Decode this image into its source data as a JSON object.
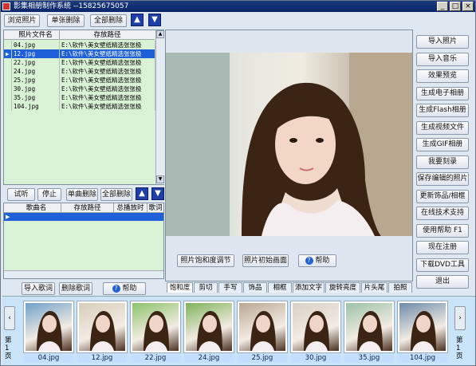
{
  "window": {
    "title": "影集相册制作系统 --15825675057"
  },
  "photo_toolbar": {
    "browse": "浏览照片",
    "delete_one": "单张删除",
    "delete_all": "全部删除"
  },
  "photo_table": {
    "headers": [
      "照片文件名",
      "存放路径"
    ],
    "rows": [
      {
        "name": "04.jpg",
        "path": "E:\\软件\\美女壁纸精选张张极"
      },
      {
        "name": "12.jpg",
        "path": "E:\\软件\\美女壁纸精选张张极"
      },
      {
        "name": "22.jpg",
        "path": "E:\\软件\\美女壁纸精选张张极"
      },
      {
        "name": "24.jpg",
        "path": "E:\\软件\\美女壁纸精选张张极"
      },
      {
        "name": "25.jpg",
        "path": "E:\\软件\\美女壁纸精选张张极"
      },
      {
        "name": "30.jpg",
        "path": "E:\\软件\\美女壁纸精选张张极"
      },
      {
        "name": "35.jpg",
        "path": "E:\\软件\\美女壁纸精选张张极"
      },
      {
        "name": "104.jpg",
        "path": "E:\\软件\\美女壁纸精选张张极"
      }
    ],
    "selected_index": 1
  },
  "music_toolbar": {
    "listen": "试听",
    "stop": "停止",
    "delete_one": "单曲删除",
    "delete_all": "全部删除"
  },
  "music_table": {
    "headers": [
      "歌曲名",
      "存放路径",
      "总播放时间",
      "歌词"
    ]
  },
  "lyrics_toolbar": {
    "import": "导入歌词",
    "delete": "删除歌词",
    "help": "帮助"
  },
  "preview_toolbar": {
    "saturation": "照片饱和度调节",
    "init": "照片初始画面",
    "help": "帮助"
  },
  "tabs": [
    "饱和度",
    "剪切",
    "手写",
    "饰品",
    "相框",
    "添加文字",
    "旋转亮度",
    "片头尾",
    "拍照"
  ],
  "side_buttons": [
    "导入照片",
    "导入音乐",
    "效果预览",
    "生成电子相册",
    "生成Flash相册",
    "生成视频文件",
    "生成GIF相册",
    "我要刻录",
    "保存编辑的照片",
    "更新饰品/相框",
    "在线技术支持",
    "使用帮助 F1",
    "现在注册",
    "下载DVD工具",
    "退出"
  ],
  "thumbnails": [
    "04.jpg",
    "12.jpg",
    "22.jpg",
    "24.jpg",
    "25.jpg",
    "30.jpg",
    "35.jpg",
    "104.jpg"
  ],
  "pager": {
    "left": "第1页",
    "right": "第1页"
  }
}
